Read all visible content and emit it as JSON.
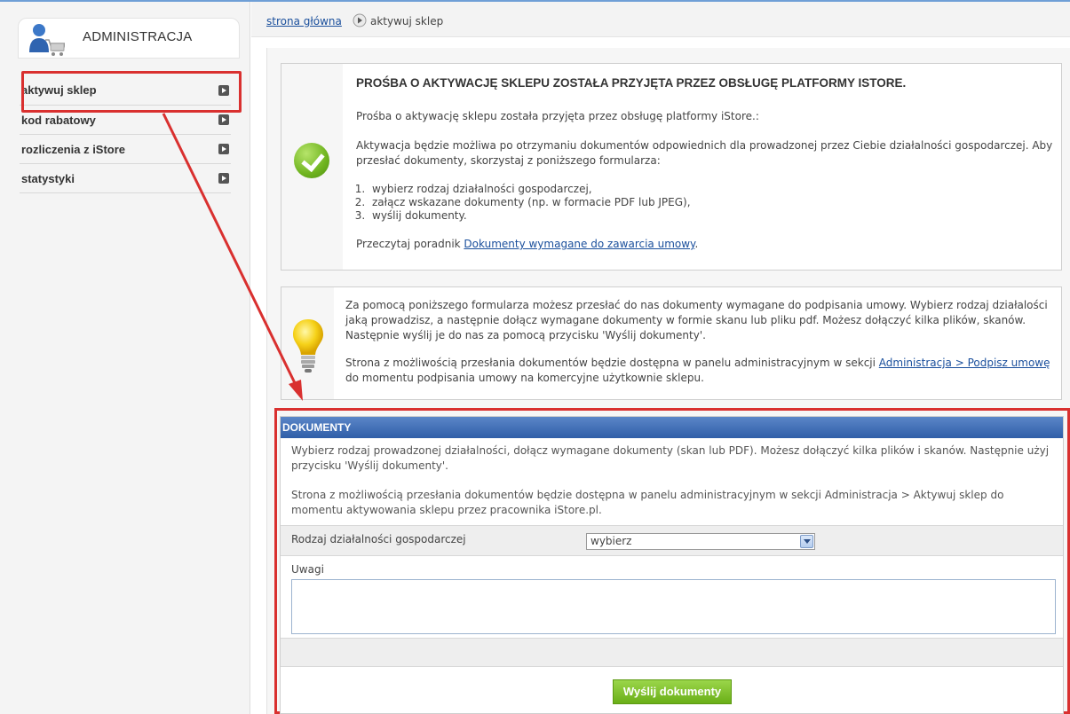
{
  "sidebar": {
    "title": "ADMINISTRACJA",
    "items": [
      {
        "label": "aktywuj sklep"
      },
      {
        "label": "kod rabatowy"
      },
      {
        "label": "rozliczenia z iStore"
      },
      {
        "label": "statystyki"
      }
    ]
  },
  "breadcrumb": {
    "home": "strona główna",
    "current": "aktywuj sklep"
  },
  "notice": {
    "title": "PROŚBA O AKTYWACJĘ SKLEPU ZOSTAŁA PRZYJĘTA PRZEZ OBSŁUGĘ PLATFORMY ISTORE.",
    "p1": "Prośba o aktywację sklepu została przyjęta przez obsługę platformy iStore.:",
    "p2": "Aktywacja będzie możliwa po otrzymaniu dokumentów odpowiednich dla prowadzonej przez Ciebie działalności gospodarczej. Aby przesłać dokumenty, skorzystaj z poniższego formularza:",
    "steps": [
      "wybierz rodzaj działalności gospodarczej,",
      "załącz wskazane dokumenty (np. w formacie PDF lub JPEG),",
      "wyślij dokumenty."
    ],
    "guide_prefix": "Przeczytaj poradnik ",
    "guide_link": "Dokumenty wymagane do zawarcia umowy",
    "guide_suffix": "."
  },
  "tip": {
    "p1": "Za pomocą poniższego formularza możesz przesłać do nas dokumenty wymagane do podpisania umowy. Wybierz rodzaj działalości jaką prowadzisz, a następnie dołącz wymagane dokumenty w formie skanu lub pliku pdf. Możesz dołączyć kilka plików, skanów. Następnie wyślij je do nas za pomocą przycisku 'Wyślij dokumenty'.",
    "p2_prefix": "Strona z możliwością przesłania dokumentów będzie dostępna w panelu administracyjnym w sekcji ",
    "p2_link": "Administracja > Podpisz umowę",
    "p2_suffix": " do momentu podpisania umowy na komercyjne użytkownie sklepu."
  },
  "documents": {
    "header": "DOKUMENTY",
    "desc1": "Wybierz rodzaj prowadzonej działalności, dołącz wymagane dokumenty (skan lub PDF). Możesz dołączyć kilka plików i skanów. Następnie użyj przycisku 'Wyślij dokumenty'.",
    "desc2": "Strona z możliwością przesłania dokumentów będzie dostępna w panelu administracyjnym w sekcji Administracja > Aktywuj sklep do momentu aktywowania sklepu przez pracownika iStore.pl.",
    "business_type_label": "Rodzaj działalności gospodarczej",
    "business_type_value": "wybierz",
    "notes_label": "Uwagi",
    "submit_label": "Wyślij dokumenty"
  },
  "colors": {
    "accent_blue": "#3f6db4",
    "highlight_red": "#d9302f",
    "button_green": "#6aaf17"
  }
}
